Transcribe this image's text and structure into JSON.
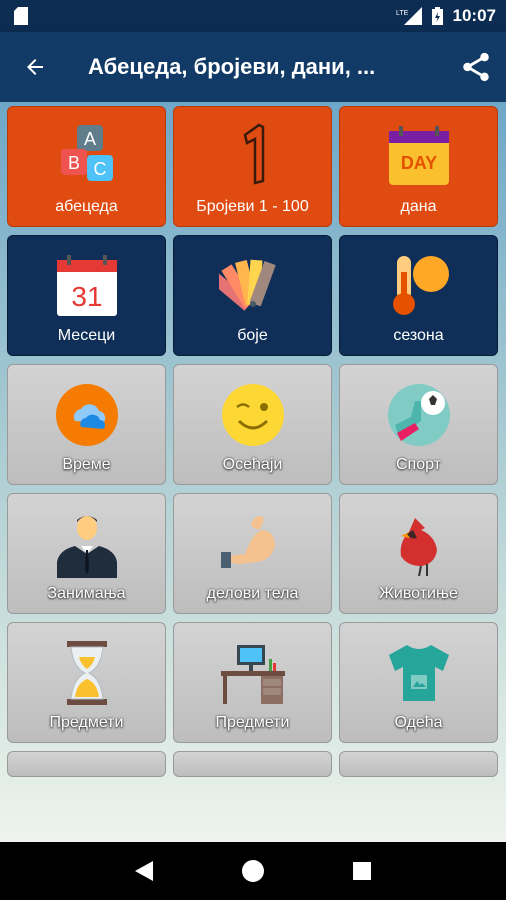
{
  "status": {
    "time": "10:07",
    "network": "LTE",
    "icons": [
      "sd-card-icon",
      "lte-signal-icon",
      "battery-icon"
    ]
  },
  "app_bar": {
    "title": "Абецеда, бројеви, дани, ...",
    "back_icon": "arrow-back-icon",
    "share_icon": "share-icon"
  },
  "tiles": [
    {
      "label": "абецеда",
      "style": "orange",
      "icon": "abc-blocks-icon"
    },
    {
      "label": "Бројеви 1 - 100",
      "style": "orange",
      "icon": "number-one-icon"
    },
    {
      "label": "дана",
      "style": "orange",
      "icon": "day-calendar-icon",
      "icon_text": "DAY"
    },
    {
      "label": "Месеци",
      "style": "navy",
      "icon": "calendar-31-icon",
      "icon_text": "31"
    },
    {
      "label": "боје",
      "style": "navy",
      "icon": "color-swatches-icon"
    },
    {
      "label": "сезона",
      "style": "navy",
      "icon": "thermometer-sun-icon"
    },
    {
      "label": "Време",
      "style": "gray",
      "icon": "weather-cloud-icon"
    },
    {
      "label": "Осећаји",
      "style": "gray",
      "icon": "wink-face-icon"
    },
    {
      "label": "Спорт",
      "style": "gray",
      "icon": "soccer-icon"
    },
    {
      "label": "Занимања",
      "style": "gray",
      "icon": "businessman-icon"
    },
    {
      "label": "делови тела",
      "style": "gray",
      "icon": "flexed-arm-icon"
    },
    {
      "label": "Животиње",
      "style": "gray",
      "icon": "cardinal-bird-icon"
    },
    {
      "label": "Предмети",
      "style": "gray",
      "icon": "hourglass-icon"
    },
    {
      "label": "Предмети",
      "style": "gray",
      "icon": "desk-computer-icon"
    },
    {
      "label": "Одећа",
      "style": "gray",
      "icon": "tshirt-icon"
    }
  ],
  "nav": {
    "back": "nav-back-icon",
    "home": "nav-home-icon",
    "recents": "nav-recents-icon"
  },
  "colors": {
    "status_bar": "#0d2c52",
    "app_bar": "#123a66",
    "tile_orange": "#e04b12",
    "tile_navy": "#0f2f58",
    "tile_gray": "#c8c8c8"
  }
}
